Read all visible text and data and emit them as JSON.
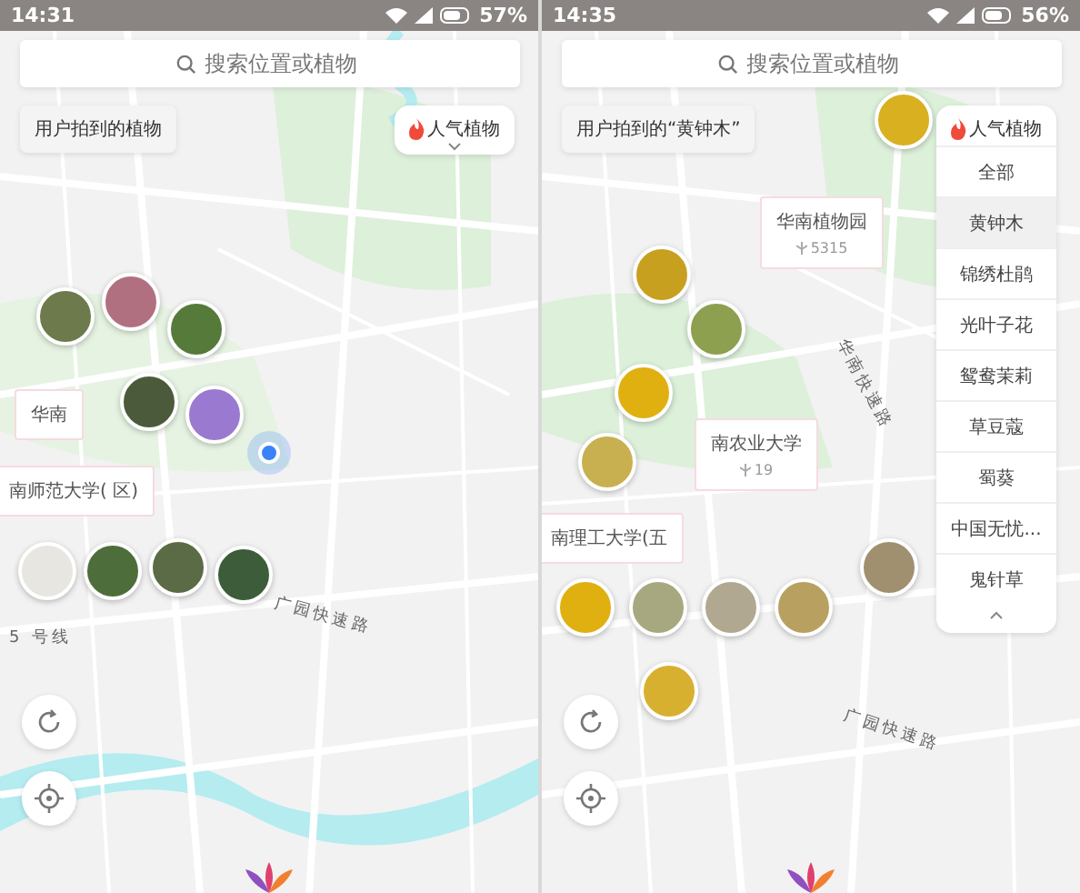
{
  "screens": [
    {
      "status_bar": {
        "time": "14:31",
        "battery": "57%"
      },
      "search": {
        "placeholder": "搜索位置或植物"
      },
      "filter_chip": "用户拍到的植物",
      "popular_button": {
        "label": "人气植物",
        "expanded": false
      },
      "place_cards": [
        {
          "name": "华南"
        },
        {
          "name": "南师范大学(",
          "suffix": "区)"
        }
      ],
      "road_labels": [
        {
          "text": "5 号线"
        },
        {
          "text": "广园快速路"
        }
      ],
      "location_dot": true
    },
    {
      "status_bar": {
        "time": "14:35",
        "battery": "56%"
      },
      "search": {
        "placeholder": "搜索位置或植物"
      },
      "filter_chip": "用户拍到的“黄钟木”",
      "popular_button": {
        "label": "人气植物",
        "expanded": true
      },
      "dropdown": [
        {
          "label": "全部",
          "selected": false
        },
        {
          "label": "黄钟木",
          "selected": true
        },
        {
          "label": "锦绣杜鹃",
          "selected": false
        },
        {
          "label": "光叶子花",
          "selected": false
        },
        {
          "label": "鸳鸯茉莉",
          "selected": false
        },
        {
          "label": "草豆蔻",
          "selected": false
        },
        {
          "label": "蜀葵",
          "selected": false
        },
        {
          "label": "中国无忧...",
          "selected": false
        },
        {
          "label": "鬼针草",
          "selected": false
        }
      ],
      "place_cards": [
        {
          "name": "华南植物园",
          "count": "5315"
        },
        {
          "name": "南农业大学",
          "count": "19"
        },
        {
          "name": "南理工大学(五"
        }
      ],
      "road_labels": [
        {
          "text": "华南快速路"
        },
        {
          "text": "广园快速路"
        }
      ]
    }
  ]
}
